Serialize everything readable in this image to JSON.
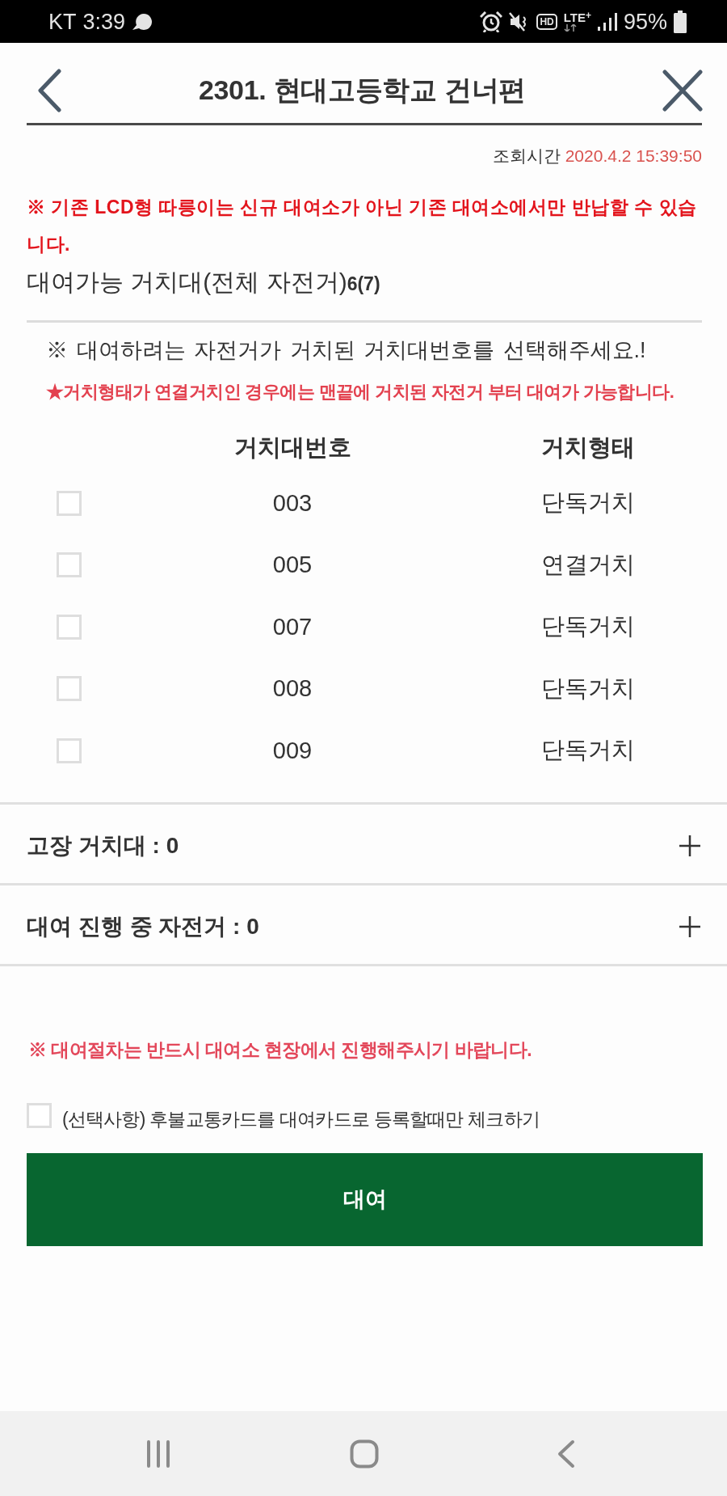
{
  "status_bar": {
    "carrier": "KT",
    "time": "3:39",
    "hd": "HD",
    "network": "LTE$^{+}$",
    "battery": "95%"
  },
  "header": {
    "title": "2301. 현대고등학교 건너편"
  },
  "query_time": {
    "label": "조회시간",
    "value": "2020.4.2 15:39:50"
  },
  "warning": "※ 기존 LCD형 따릉이는 신규 대여소가 아닌 기존 대여소에서만 반납할 수 있습니다.",
  "availability": {
    "label": "대여가능 거치대(전체 자전거)",
    "count": "6(7)"
  },
  "instruction": "※ 대여하려는 자전거가 거치된 거치대번호를 선택해주세요.!",
  "dock_notice": "★거치형태가 연결거치인 경우에는 맨끝에 거치된 자전거 부터 대여가 가능합니다.",
  "table": {
    "columns": [
      "거치대번호",
      "거치형태"
    ],
    "rows": [
      {
        "checked": false,
        "dock_number": "003",
        "dock_type": "단독거치"
      },
      {
        "checked": false,
        "dock_number": "005",
        "dock_type": "연결거치"
      },
      {
        "checked": false,
        "dock_number": "007",
        "dock_type": "단독거치"
      },
      {
        "checked": false,
        "dock_number": "008",
        "dock_type": "단독거치"
      },
      {
        "checked": false,
        "dock_number": "009",
        "dock_type": "단독거치"
      }
    ]
  },
  "sections": [
    {
      "label": "고장 거치대 : 0",
      "expanded": false
    },
    {
      "label": "대여 진행 중 자전거 : 0",
      "expanded": false
    }
  ],
  "procedure_notice": "※ 대여절차는 반드시 대여소 현장에서 진행해주시기 바랍니다.",
  "postpaid_option": {
    "label": "(선택사항) 후불교통카드를 대여카드로 등록할때만 체크하기",
    "checked": false
  },
  "rent_button": {
    "label": "대여"
  }
}
